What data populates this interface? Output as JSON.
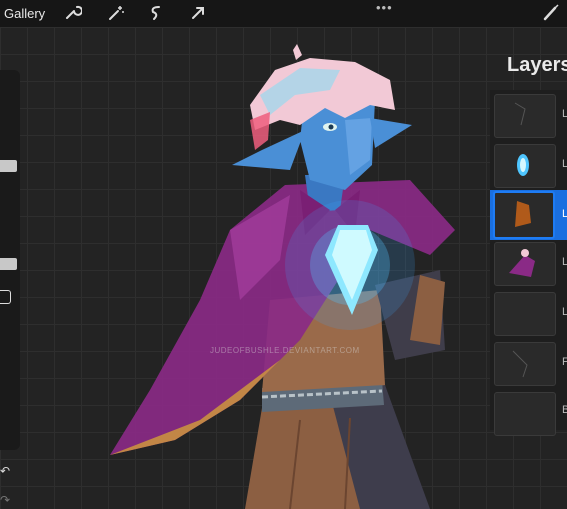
{
  "topbar": {
    "gallery_label": "Gallery",
    "more_label": "•••",
    "tools": [
      "wrench-icon",
      "magic-wand-icon",
      "selection-icon",
      "transform-arrow-icon"
    ],
    "brush_icon": "brush-icon"
  },
  "sidebar": {
    "undo_label": "↶",
    "redo_label": "↷"
  },
  "layers": {
    "title": "Layers",
    "rows": [
      {
        "letter": "L"
      },
      {
        "letter": "L"
      },
      {
        "letter": "L"
      },
      {
        "letter": "L"
      },
      {
        "letter": "L"
      },
      {
        "letter": "F"
      },
      {
        "letter": "B"
      }
    ],
    "active_index": 2
  },
  "watermark": "JUDEOFBUSHLE.DEVIANTART.COM",
  "colors": {
    "accent": "#1e7cf4",
    "cloak": "#8a2a86",
    "skin": "#4a8fd6",
    "hair": "#f2c9d6",
    "robe": "#9a6a4a"
  }
}
